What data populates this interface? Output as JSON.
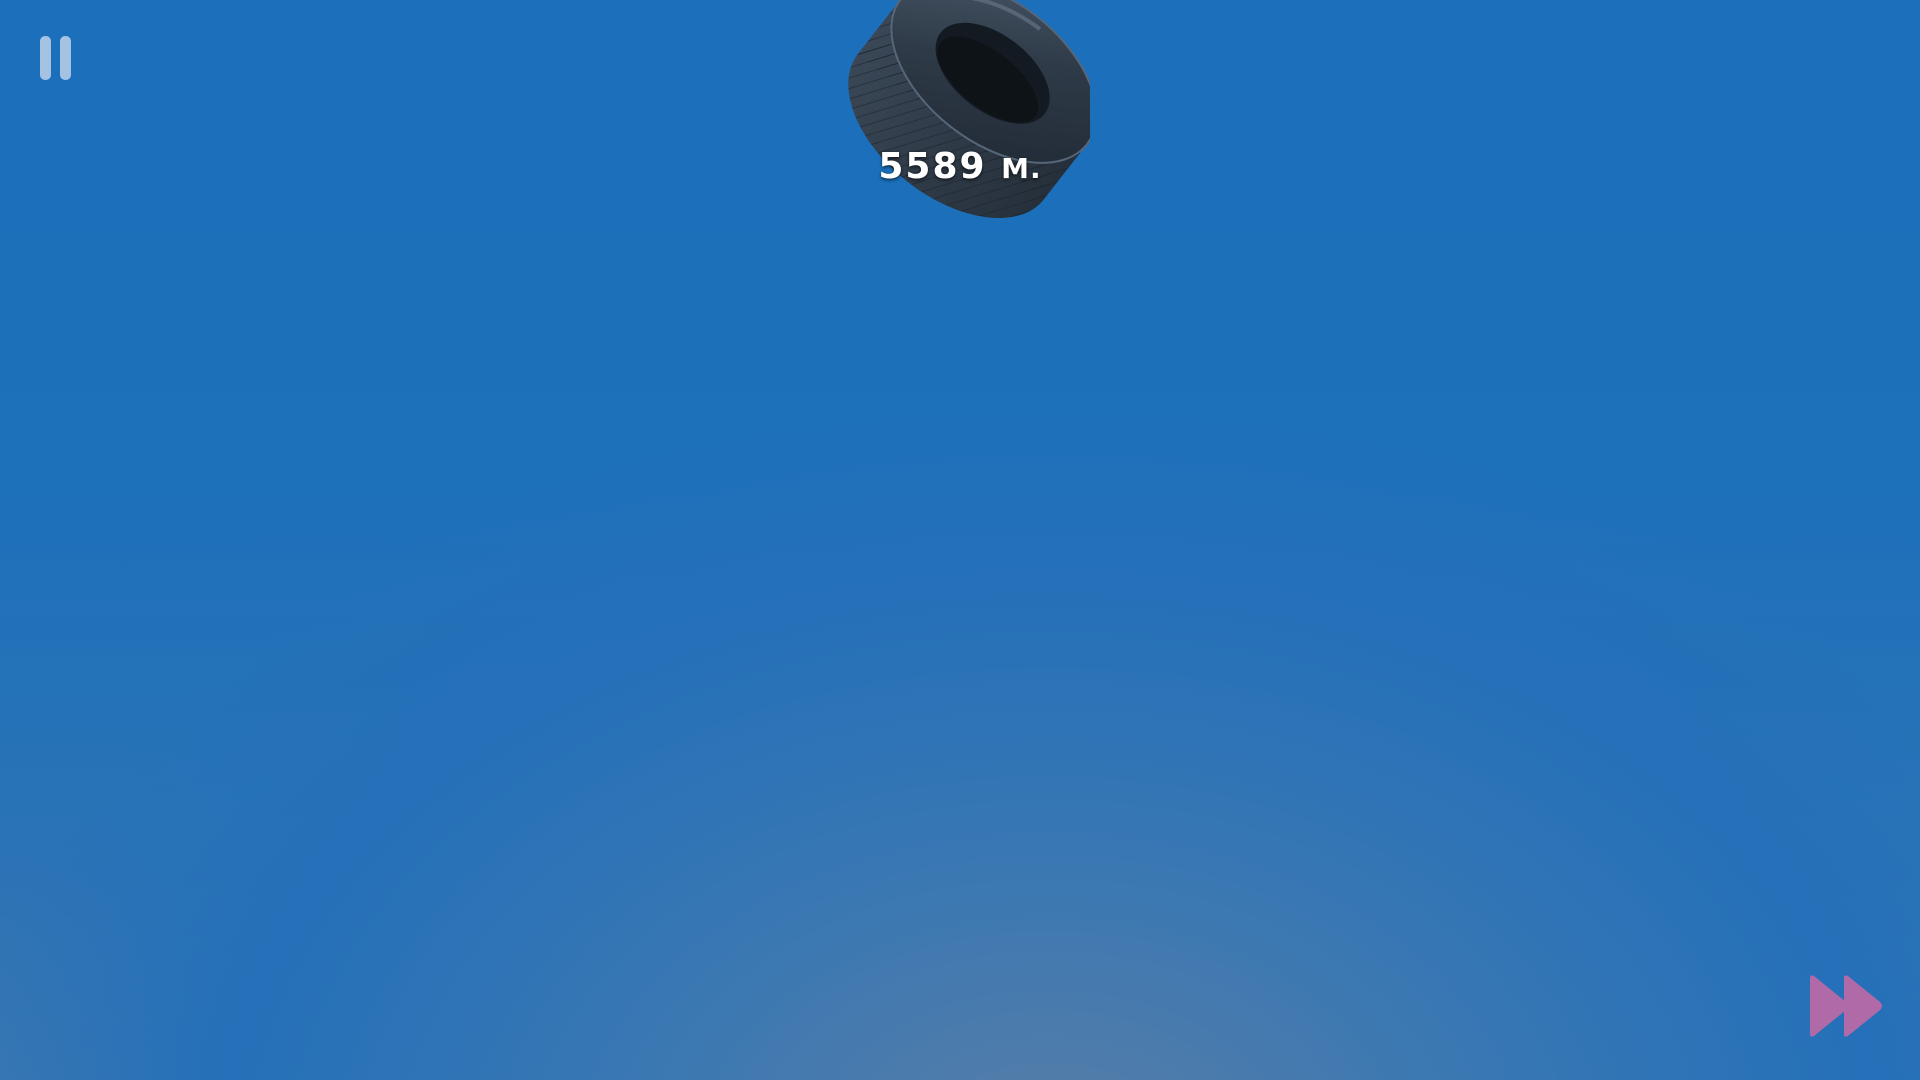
{
  "hud": {
    "distance_value": "5589",
    "distance_unit": "М."
  },
  "icons": {
    "pause": "pause-icon",
    "fast_forward": "fast-forward-icon",
    "game_object": "tire"
  },
  "colors": {
    "sky_top": "#1b6fbb",
    "sky_bottom_glow": "#5a7fa6",
    "pause_icon": "#cddaee",
    "fast_forward_icon": "#b06aa8",
    "distance_text": "#ffffff"
  }
}
